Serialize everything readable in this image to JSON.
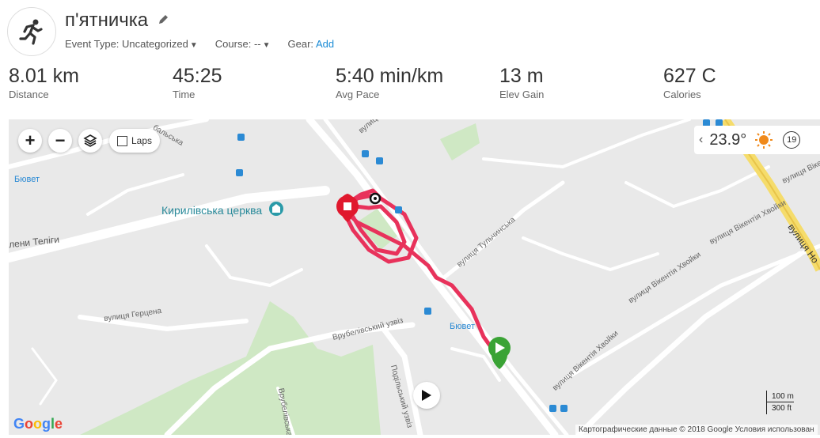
{
  "activity": {
    "title": "п'ятничка",
    "event_type_label": "Event Type:",
    "event_type_value": "Uncategorized",
    "course_label": "Course:",
    "course_value": "--",
    "gear_label": "Gear:",
    "gear_link": "Add"
  },
  "stats": [
    {
      "value": "8.01 km",
      "label": "Distance"
    },
    {
      "value": "45:25",
      "label": "Time"
    },
    {
      "value": "5:40 min/km",
      "label": "Avg Pace"
    },
    {
      "value": "13 m",
      "label": "Elev Gain"
    },
    {
      "value": "627 C",
      "label": "Calories"
    }
  ],
  "map": {
    "laps_label": "Laps",
    "weather_temp": "23.9°",
    "weather_wind": "19",
    "church": "Кирилівська церква",
    "streets": {
      "teligi": "лени Теліги",
      "herzen": "вулиця Герцена",
      "vrubelivsky": "Врубелівський узвіз",
      "podilsky": "Подільський узвіз",
      "tulchynska": "вулиця Тульчинська",
      "khvoiky1": "вулиця Вікентія Хвойки",
      "khvoiky2": "вулиця Вікентія Хвойки",
      "khvoiky3": "вулиця Вікентія Хвойки",
      "vikent": "вулиця Вікен",
      "north_top": "вулиця",
      "rybalska": "бальська",
      "no": "вулиця Но",
      "vrub_vert": "Врубелівська",
      "biuvet1": "Бювет",
      "biuvet2": "Бювет"
    },
    "scale_top": "100 m",
    "scale_bottom": "300 ft",
    "attribution": "Картографические данные © 2018 Google    Условия использован",
    "google": "Google"
  },
  "colors": {
    "route": "#e8325b",
    "start_pin": "#3aa335",
    "end_pin": "#e0182d",
    "link": "#1a8bd6"
  },
  "icons": {
    "activity": "running-icon",
    "edit": "pencil-icon",
    "zoom_in": "plus-icon",
    "zoom_out": "minus-icon",
    "layers": "layers-icon",
    "weather": "sun-icon",
    "play": "play-icon"
  }
}
